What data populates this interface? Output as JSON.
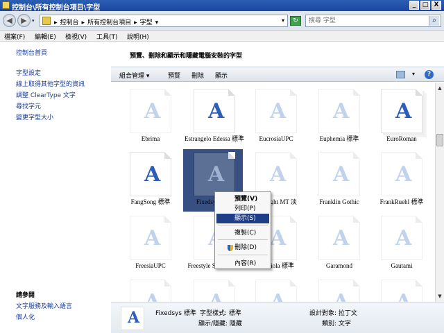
{
  "window": {
    "title": "控制台\\所有控制台項目\\字型",
    "minimize": "_",
    "maximize": "□",
    "close": "X"
  },
  "address": {
    "crumbs": [
      "▸",
      "控制台",
      "▸",
      "所有控制台項目",
      "▸",
      "字型",
      "▾"
    ],
    "search_placeholder": "搜尋 字型"
  },
  "menu": [
    "檔案(F)",
    "編輯(E)",
    "檢視(V)",
    "工具(T)",
    "說明(H)"
  ],
  "left": {
    "links": [
      "控制台首頁",
      "字型設定",
      "線上取得其他字型的資訊",
      "調整 ClearType 文字",
      "尋找字元",
      "變更字型大小"
    ],
    "see_also": "請參閱",
    "see_links": [
      "文字服務及輸入語言",
      "個人化"
    ]
  },
  "main": {
    "heading": "預覽、刪除和顯示和隱藏電腦安裝的字型",
    "toolbar": [
      "組合管理 ▾",
      "預覽",
      "刪除",
      "顯示"
    ],
    "help": "?"
  },
  "fonts": [
    {
      "name": "Ebrima",
      "dim": true
    },
    {
      "name": "Estrangelo Edessa 標準",
      "dim": false
    },
    {
      "name": "EucrosiaUPC",
      "dim": true
    },
    {
      "name": "Euphemia 標準",
      "dim": true
    },
    {
      "name": "EuroRoman",
      "dim": false,
      "stack": true
    },
    {
      "name": "FangSong 標準",
      "dim": false
    },
    {
      "name": "Fixedsys 標準",
      "dim": true,
      "selected": true
    },
    {
      "name": "Footlight MT 淡",
      "dim": true
    },
    {
      "name": "Franklin Gothic",
      "dim": true
    },
    {
      "name": "FrankRuehl 標準",
      "dim": true
    },
    {
      "name": "FreesiaUPC",
      "dim": true
    },
    {
      "name": "Freestyle Script 標準",
      "dim": true
    },
    {
      "name": "Gabriola 標準",
      "dim": true
    },
    {
      "name": "Garamond",
      "dim": true
    },
    {
      "name": "Gautami",
      "dim": true
    },
    {
      "name": "",
      "dim": true
    },
    {
      "name": "",
      "dim": true
    },
    {
      "name": "",
      "dim": true
    },
    {
      "name": "",
      "dim": true
    },
    {
      "name": "",
      "dim": true
    }
  ],
  "glyph": "A",
  "details": {
    "name": "Fixedsys 標準",
    "style_label": "字型樣式: 標準",
    "show_label": "顯示/隱藏: 隱藏",
    "design_label": "設計對象: 拉丁文",
    "category_label": "類別: 文字"
  },
  "context_menu": [
    {
      "label": "預覽(V)",
      "bold": true
    },
    {
      "label": "列印(P)"
    },
    {
      "label": "顯示(S)",
      "highlight": true
    },
    {
      "label": "複製(C)"
    },
    {
      "label": "刪除(D)",
      "shield": true
    },
    {
      "label": "內容(R)"
    }
  ]
}
